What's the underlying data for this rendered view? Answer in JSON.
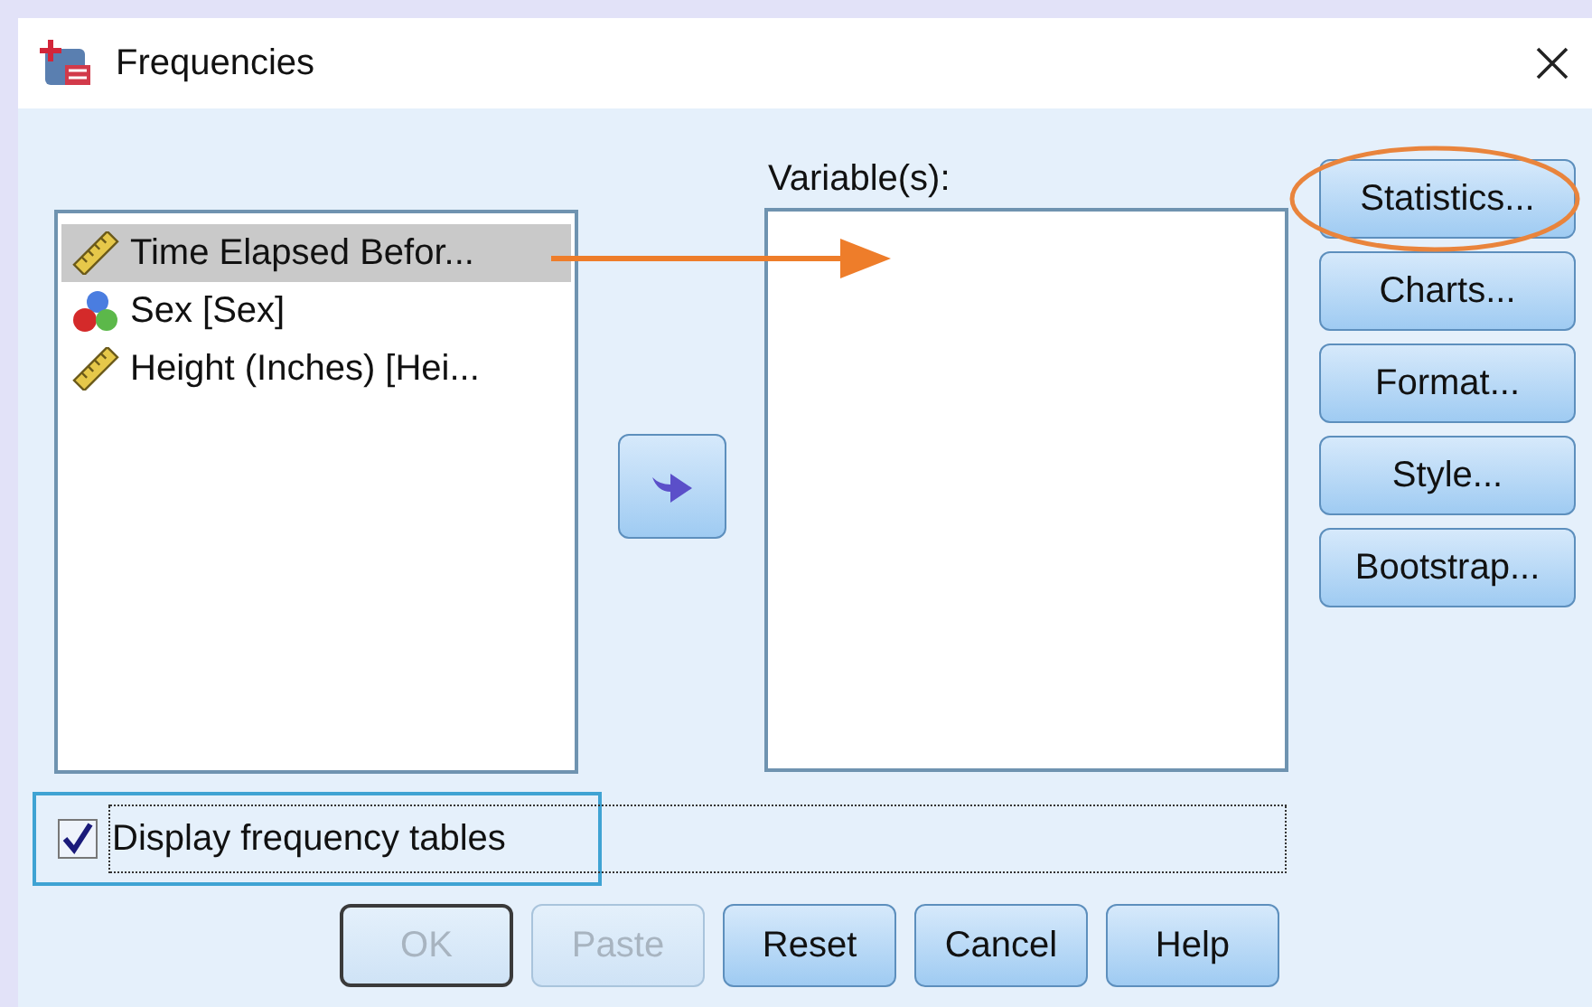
{
  "window": {
    "title": "Frequencies"
  },
  "source_list": {
    "items": [
      {
        "label": "Time Elapsed Befor...",
        "kind": "scale",
        "selected": true
      },
      {
        "label": "Sex [Sex]",
        "kind": "nominal",
        "selected": false
      },
      {
        "label": "Height (Inches) [Hei...",
        "kind": "scale",
        "selected": false
      }
    ]
  },
  "variables": {
    "label": "Variable(s):"
  },
  "side_buttons": [
    {
      "label": "Statistics..."
    },
    {
      "label": "Charts..."
    },
    {
      "label": "Format..."
    },
    {
      "label": "Style..."
    },
    {
      "label": "Bootstrap..."
    }
  ],
  "display_frequency_tables": {
    "label": "Display frequency tables",
    "checked": true
  },
  "buttons": [
    {
      "label": "OK",
      "disabled": true,
      "default": true
    },
    {
      "label": "Paste",
      "disabled": true,
      "default": false
    },
    {
      "label": "Reset",
      "disabled": false,
      "default": false
    },
    {
      "label": "Cancel",
      "disabled": false,
      "default": false
    },
    {
      "label": "Help",
      "disabled": false,
      "default": false
    }
  ]
}
